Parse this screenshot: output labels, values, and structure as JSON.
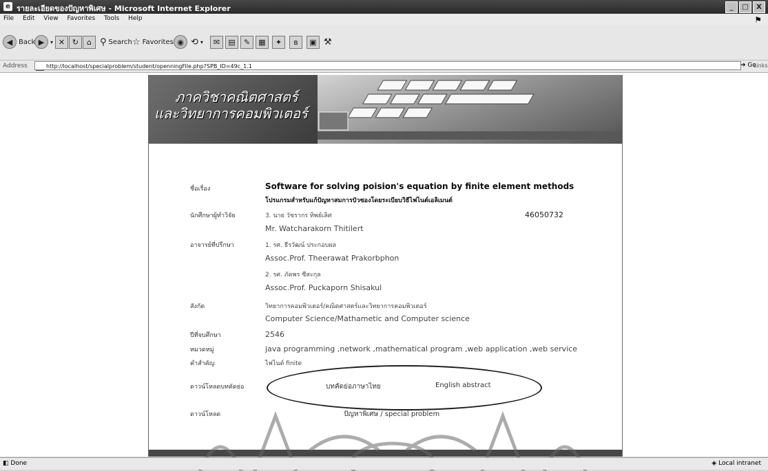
{
  "window": {
    "title": "รายละเอียดของปัญหาพิเศษ - Microsoft Internet Explorer",
    "controls": [
      "_",
      "□",
      "X"
    ]
  },
  "menu": [
    "File",
    "Edit",
    "View",
    "Favorites",
    "Tools",
    "Help"
  ],
  "toolbar": {
    "back_label": "Back",
    "search_label": "Search",
    "favorites_label": "Favorites"
  },
  "address": {
    "label": "Address",
    "url": "http://localhost/specialproblem/student/openningFile.php?SPB_ID=49c_1.1",
    "go_label": "Go",
    "links_label": "Links"
  },
  "banner": {
    "title_line1": "ภาควิชาคณิตศาสตร์",
    "title_line2": "และวิทยาการคอมพิวเตอร์"
  },
  "details": {
    "topic_label": "ชื่อเรื่อง",
    "title_en": "Software for solving poision's equation by finite element methods",
    "title_th": "โปรแกรมสำหรับแก้ปัญหาสมการปัวซองโดยระเบียบวิธีไฟไนต์เอลิเมนต์",
    "researcher_label": "นักศึกษาผู้ทำวิจัย",
    "researcher_th": "3. นาย วัชรากร ทิพย์เลิศ",
    "student_id": "46050732",
    "researcher_en": "Mr. Watcharakorn Thitilert",
    "advisor_label": "อาจารย์ที่ปรึกษา",
    "advisor1_th": "1. รศ. ธีรวัฒน์ ประกอบผล",
    "advisor1_en": "Assoc.Prof. Theerawat Prakorbphon",
    "advisor2_th": "2. รศ. ภัคพร ซีสะกุล",
    "advisor2_en": "Assoc.Prof. Puckaporn Shisakul",
    "dept_label": "สังกัด",
    "dept_th": "วิทยาการคอมพิวเตอร์/คณิตศาสตร์และวิทยาการคอมพิวเตอร์",
    "dept_en": "Computer Science/Mathametic and Computer science",
    "year_label": "ปีที่จบศึกษา",
    "year": "2546",
    "category_label": "หมวดหมู่",
    "category": "java programming ,network ,mathematical program ,web application ,web service",
    "keyword_label": "คำสำคัญ",
    "keyword": "ไฟไนต์ finite",
    "abstract_label": "ดาวน์โหลดบทคัดย่อ",
    "abstract_th": "บทคัดย่อภาษาไทย",
    "abstract_en": "English abstract",
    "download_label": "ดาวน์โหลด",
    "download_link": "ปัญหาพิเศษ / special problem"
  },
  "status": {
    "left": "Done",
    "right": "Local intranet"
  }
}
